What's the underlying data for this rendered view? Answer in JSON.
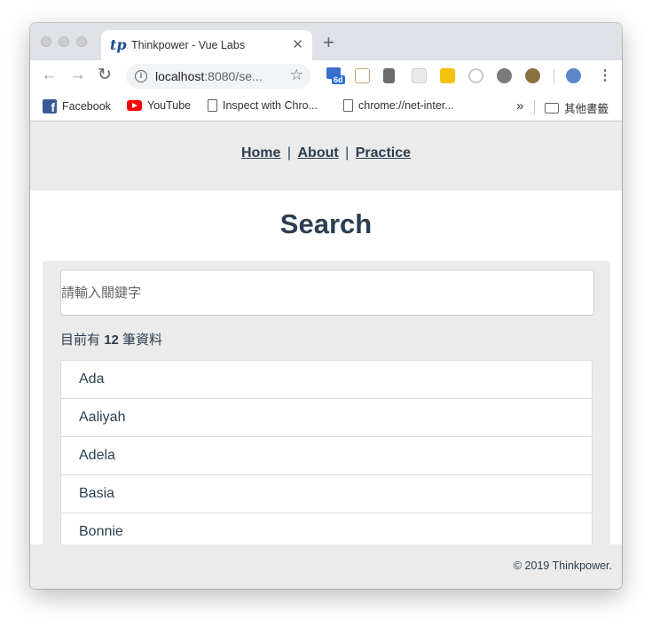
{
  "browser": {
    "tab_title": "Thinkpower - Vue Labs",
    "tab_favicon": "tp",
    "tab_close": "✕",
    "new_tab": "+",
    "url_host": "localhost",
    "url_path": ":8080/se...",
    "extension_badge": "6d",
    "bookmarks": [
      {
        "label": "Facebook",
        "icon": "facebook-icon"
      },
      {
        "label": "YouTube",
        "icon": "youtube-icon"
      },
      {
        "label": "Inspect with Chro...",
        "icon": "page-icon"
      },
      {
        "label": "chrome://net-inter...",
        "icon": "page-icon"
      }
    ],
    "bookmarks_overflow": "»",
    "other_bookmarks": "其他書籤"
  },
  "nav": {
    "home": "Home",
    "about": "About",
    "practice": "Practice",
    "separator": "|"
  },
  "search": {
    "heading": "Search",
    "placeholder": "請輸入關鍵字",
    "count_prefix": "目前有",
    "count": "12",
    "count_suffix": "筆資料"
  },
  "results": [
    "Ada",
    "Aaliyah",
    "Adela",
    "Basia",
    "Bonnie"
  ],
  "footer": {
    "copyright": "© 2019 Thinkpower."
  },
  "colors": {
    "text": "#2c3e50",
    "nav_bg": "#ebebeb",
    "tab_strip": "#dee1e6"
  }
}
